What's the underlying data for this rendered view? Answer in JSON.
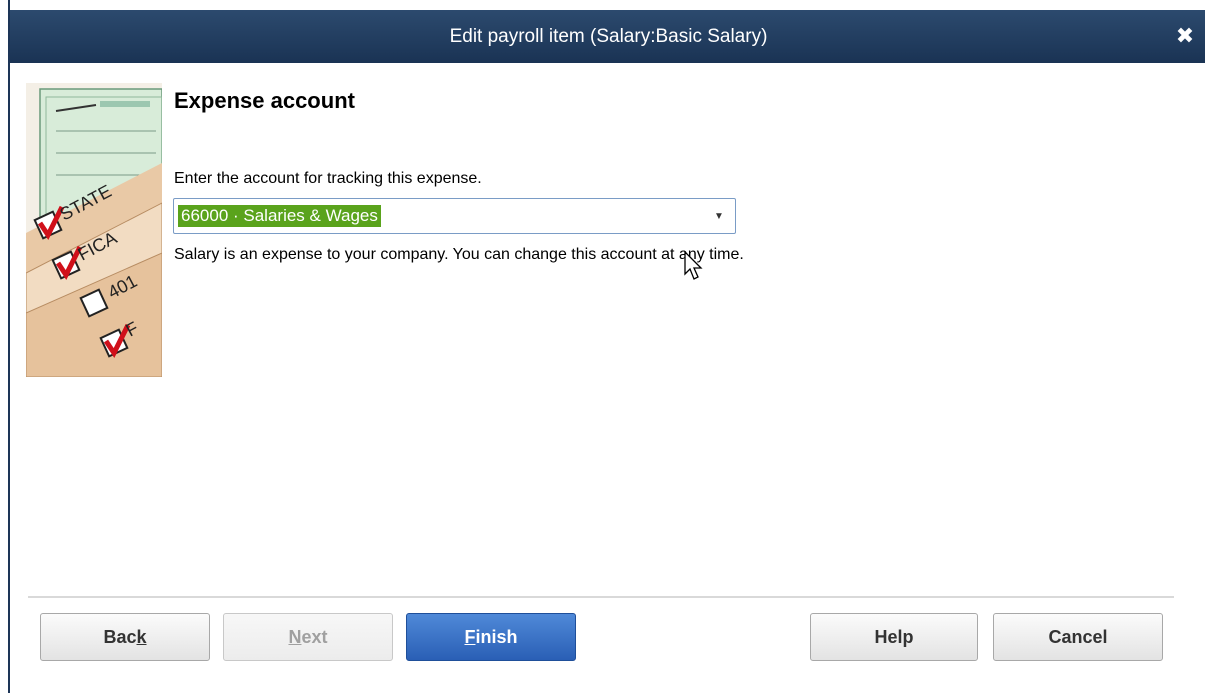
{
  "window": {
    "title": "Edit payroll item (Salary:Basic Salary)",
    "close_glyph": "✖"
  },
  "content": {
    "heading": "Expense account",
    "prompt": "Enter the account for tracking this expense.",
    "account_select": {
      "value": "66000 · Salaries & Wages"
    },
    "note": "Salary is an expense to your company. You can change this account at any time."
  },
  "side_image": {
    "labels": [
      "STATE",
      "FICA",
      "401",
      "F"
    ],
    "icon": "payroll-checklist-illustration"
  },
  "buttons": {
    "back": {
      "pre": "Bac",
      "key": "k",
      "post": ""
    },
    "next": {
      "pre": "",
      "key": "N",
      "post": "ext"
    },
    "finish": {
      "pre": "",
      "key": "F",
      "post": "inish"
    },
    "help": "Help",
    "cancel": "Cancel"
  },
  "colors": {
    "titlebar": "#1d3557",
    "selection": "#5aa31c",
    "primary_button": "#2a5fb5"
  }
}
